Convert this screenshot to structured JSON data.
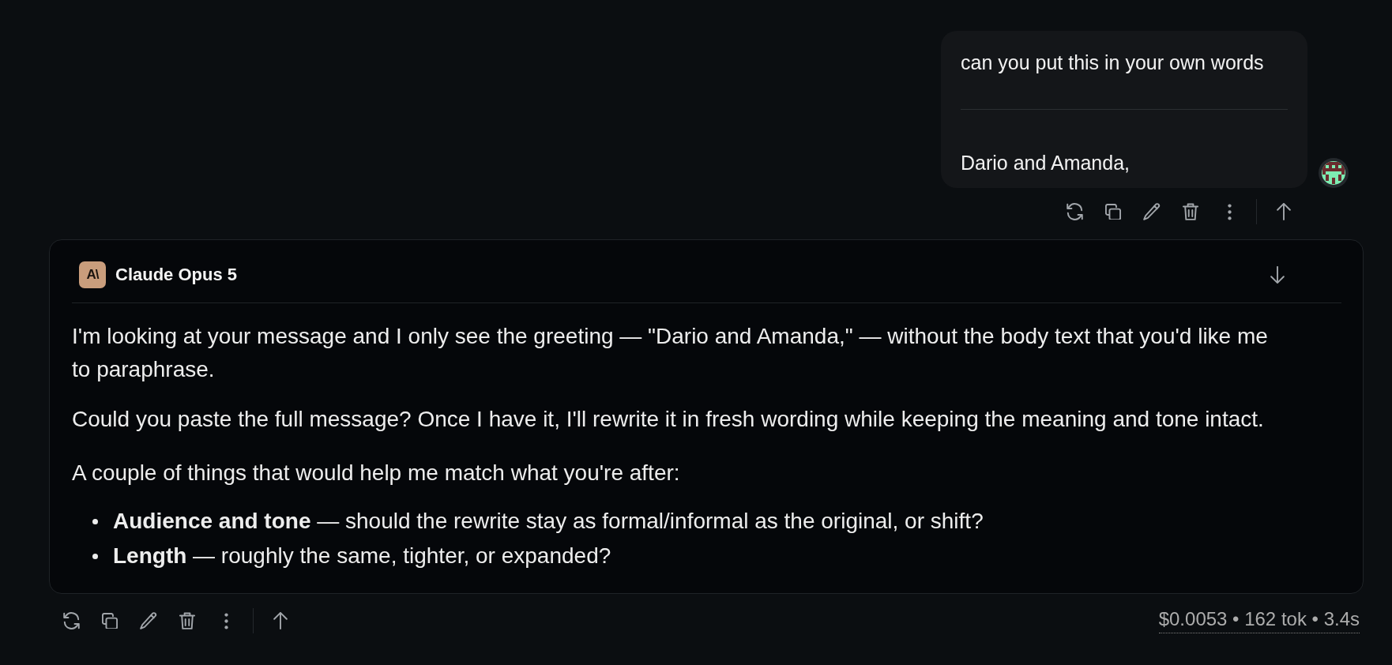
{
  "user_message": {
    "blocks": [
      {
        "kind": "paragraph",
        "text": "can you put this in your own words"
      },
      {
        "kind": "rule"
      },
      {
        "kind": "paragraph",
        "text": "Dario and Amanda,"
      }
    ]
  },
  "assistant_message": {
    "logo": "A\\",
    "model": "Claude Opus 5",
    "blocks": [
      {
        "kind": "paragraph",
        "text": "I'm looking at your message and I only see the greeting — \"Dario and Amanda,\" — without the body text that you'd like me to paraphrase."
      },
      {
        "kind": "paragraph",
        "text": "Could you paste the full message? Once I have it, I'll rewrite it in fresh wording while keeping the meaning and tone intact."
      },
      {
        "kind": "paragraph",
        "text": "A couple of things that would help me match what you're after:"
      },
      {
        "kind": "bullets",
        "items": [
          "**Audience and tone** — should the rewrite stay as formal/informal as the original, or shift?",
          "**Length** — roughly the same, tighter, or expanded?"
        ]
      }
    ]
  },
  "stats": "$0.0053 • 162 tok • 3.4s"
}
